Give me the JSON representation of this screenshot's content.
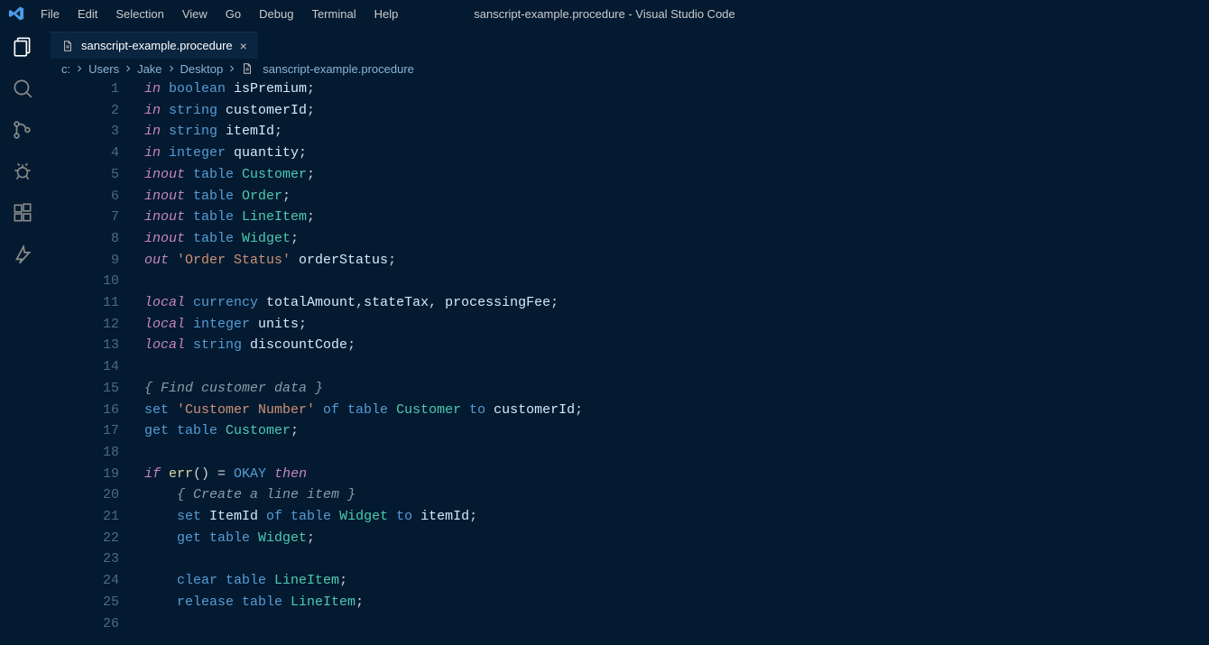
{
  "window": {
    "title": "sanscript-example.procedure - Visual Studio Code"
  },
  "menu": {
    "file": "File",
    "edit": "Edit",
    "selection": "Selection",
    "view": "View",
    "go": "Go",
    "debug": "Debug",
    "terminal": "Terminal",
    "help": "Help"
  },
  "tab": {
    "filename": "sanscript-example.procedure",
    "close_glyph": "×"
  },
  "breadcrumbs": {
    "parts": [
      "c:",
      "Users",
      "Jake",
      "Desktop"
    ],
    "filename": "sanscript-example.procedure"
  },
  "code": {
    "lines": [
      {
        "n": "1",
        "ind": 0,
        "seg": [
          [
            "kw",
            "in "
          ],
          [
            "typ",
            "boolean "
          ],
          [
            "txt",
            "isPremium"
          ],
          [
            "punc",
            ";"
          ]
        ]
      },
      {
        "n": "2",
        "ind": 0,
        "seg": [
          [
            "kw",
            "in "
          ],
          [
            "typ",
            "string "
          ],
          [
            "txt",
            "customerId"
          ],
          [
            "punc",
            ";"
          ]
        ]
      },
      {
        "n": "3",
        "ind": 0,
        "seg": [
          [
            "kw",
            "in "
          ],
          [
            "typ",
            "string "
          ],
          [
            "txt",
            "itemId"
          ],
          [
            "punc",
            ";"
          ]
        ]
      },
      {
        "n": "4",
        "ind": 0,
        "seg": [
          [
            "kw",
            "in "
          ],
          [
            "typ",
            "integer "
          ],
          [
            "txt",
            "quantity"
          ],
          [
            "punc",
            ";"
          ]
        ]
      },
      {
        "n": "5",
        "ind": 0,
        "seg": [
          [
            "kw",
            "inout "
          ],
          [
            "typ",
            "table "
          ],
          [
            "id",
            "Customer"
          ],
          [
            "punc",
            ";"
          ]
        ]
      },
      {
        "n": "6",
        "ind": 0,
        "seg": [
          [
            "kw",
            "inout "
          ],
          [
            "typ",
            "table "
          ],
          [
            "id",
            "Order"
          ],
          [
            "punc",
            ";"
          ]
        ]
      },
      {
        "n": "7",
        "ind": 0,
        "seg": [
          [
            "kw",
            "inout "
          ],
          [
            "typ",
            "table "
          ],
          [
            "id",
            "LineItem"
          ],
          [
            "punc",
            ";"
          ]
        ]
      },
      {
        "n": "8",
        "ind": 0,
        "seg": [
          [
            "kw",
            "inout "
          ],
          [
            "typ",
            "table "
          ],
          [
            "id",
            "Widget"
          ],
          [
            "punc",
            ";"
          ]
        ]
      },
      {
        "n": "9",
        "ind": 0,
        "seg": [
          [
            "kw",
            "out "
          ],
          [
            "str",
            "'Order Status' "
          ],
          [
            "txt",
            "orderStatus"
          ],
          [
            "punc",
            ";"
          ]
        ]
      },
      {
        "n": "10",
        "ind": 0,
        "seg": []
      },
      {
        "n": "11",
        "ind": 0,
        "seg": [
          [
            "kw",
            "local "
          ],
          [
            "typ",
            "currency "
          ],
          [
            "txt",
            "totalAmount"
          ],
          [
            "punc",
            ","
          ],
          [
            "txt",
            "stateTax"
          ],
          [
            "punc",
            ", "
          ],
          [
            "txt",
            "processingFee"
          ],
          [
            "punc",
            ";"
          ]
        ]
      },
      {
        "n": "12",
        "ind": 0,
        "seg": [
          [
            "kw",
            "local "
          ],
          [
            "typ",
            "integer "
          ],
          [
            "txt",
            "units"
          ],
          [
            "punc",
            ";"
          ]
        ]
      },
      {
        "n": "13",
        "ind": 0,
        "seg": [
          [
            "kw",
            "local "
          ],
          [
            "typ",
            "string "
          ],
          [
            "txt",
            "discountCode"
          ],
          [
            "punc",
            ";"
          ]
        ]
      },
      {
        "n": "14",
        "ind": 0,
        "seg": []
      },
      {
        "n": "15",
        "ind": 0,
        "seg": [
          [
            "cmt",
            "{ Find customer data }"
          ]
        ]
      },
      {
        "n": "16",
        "ind": 0,
        "seg": [
          [
            "typ",
            "set "
          ],
          [
            "str",
            "'Customer Number' "
          ],
          [
            "typ",
            "of table "
          ],
          [
            "id",
            "Customer "
          ],
          [
            "typ",
            "to "
          ],
          [
            "txt",
            "customerId"
          ],
          [
            "punc",
            ";"
          ]
        ]
      },
      {
        "n": "17",
        "ind": 0,
        "seg": [
          [
            "typ",
            "get table "
          ],
          [
            "id",
            "Customer"
          ],
          [
            "punc",
            ";"
          ]
        ]
      },
      {
        "n": "18",
        "ind": 0,
        "seg": []
      },
      {
        "n": "19",
        "ind": 0,
        "seg": [
          [
            "kw",
            "if "
          ],
          [
            "func",
            "err"
          ],
          [
            "punc",
            "() = "
          ],
          [
            "typ",
            "OKAY "
          ],
          [
            "kw",
            "then"
          ]
        ]
      },
      {
        "n": "20",
        "ind": 1,
        "seg": [
          [
            "cmt",
            "{ Create a line item }"
          ]
        ]
      },
      {
        "n": "21",
        "ind": 1,
        "seg": [
          [
            "typ",
            "set "
          ],
          [
            "txt",
            "ItemId "
          ],
          [
            "typ",
            "of table "
          ],
          [
            "id",
            "Widget "
          ],
          [
            "typ",
            "to "
          ],
          [
            "txt",
            "itemId"
          ],
          [
            "punc",
            ";"
          ]
        ]
      },
      {
        "n": "22",
        "ind": 1,
        "seg": [
          [
            "typ",
            "get table "
          ],
          [
            "id",
            "Widget"
          ],
          [
            "punc",
            ";"
          ]
        ]
      },
      {
        "n": "23",
        "ind": 1,
        "seg": []
      },
      {
        "n": "24",
        "ind": 1,
        "seg": [
          [
            "typ",
            "clear table "
          ],
          [
            "id",
            "LineItem"
          ],
          [
            "punc",
            ";"
          ]
        ]
      },
      {
        "n": "25",
        "ind": 1,
        "seg": [
          [
            "typ",
            "release table "
          ],
          [
            "id",
            "LineItem"
          ],
          [
            "punc",
            ";"
          ]
        ]
      },
      {
        "n": "26",
        "ind": 1,
        "seg": []
      }
    ]
  }
}
